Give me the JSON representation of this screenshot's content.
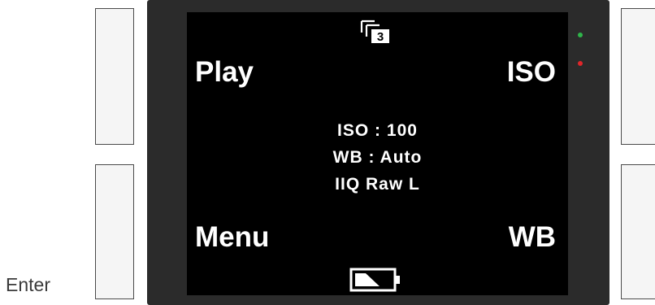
{
  "side_label": "Enter",
  "screen": {
    "top_left": "Play",
    "top_right": "ISO",
    "bottom_left": "Menu",
    "bottom_right": "WB",
    "info_lines": [
      "ISO : 100",
      "WB : Auto",
      "IIQ Raw L"
    ],
    "stack_count": "3"
  },
  "icons": {
    "stack": "image-stack-icon",
    "battery": "battery-icon"
  },
  "indicators": {
    "green_led": "#2fb54a",
    "red_led": "#e0262a"
  },
  "colors": {
    "screen_bg": "#000000",
    "bezel": "#2b2b2b",
    "button_face": "#f5f5f5",
    "text": "#ffffff"
  }
}
